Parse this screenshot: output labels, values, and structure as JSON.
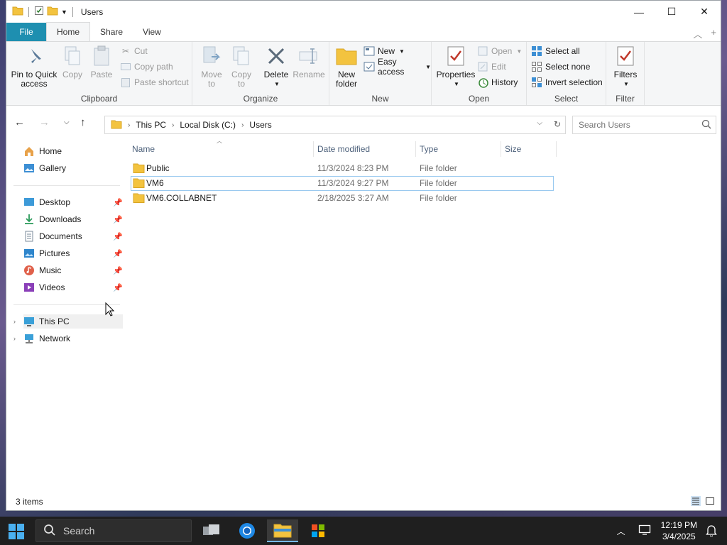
{
  "window": {
    "title": "Users",
    "controls": {
      "minimize": "—",
      "maximize": "☐",
      "close": "✕"
    }
  },
  "ribbon_tabs": [
    {
      "label": "File"
    },
    {
      "label": "Home"
    },
    {
      "label": "Share"
    },
    {
      "label": "View"
    }
  ],
  "ribbon": {
    "clipboard": {
      "group_label": "Clipboard",
      "pin": "Pin to Quick access",
      "pin_l1": "Pin to Quick",
      "pin_l2": "access",
      "copy": "Copy",
      "paste": "Paste",
      "cut": "Cut",
      "copy_path": "Copy path",
      "paste_shortcut": "Paste shortcut"
    },
    "organize": {
      "group_label": "Organize",
      "move_l1": "Move",
      "move_l2": "to",
      "copy_l1": "Copy",
      "copy_l2": "to",
      "delete": "Delete",
      "rename": "Rename"
    },
    "new": {
      "group_label": "New",
      "new_folder_l1": "New",
      "new_folder_l2": "folder",
      "new_item": "New",
      "easy_access": "Easy access"
    },
    "open": {
      "group_label": "Open",
      "properties": "Properties",
      "open": "Open",
      "edit": "Edit",
      "history": "History"
    },
    "select": {
      "group_label": "Select",
      "select_all": "Select all",
      "select_none": "Select none",
      "invert": "Invert selection"
    },
    "filter": {
      "group_label": "Filter",
      "filters": "Filters"
    }
  },
  "address": {
    "crumbs": [
      "This PC",
      "Local Disk (C:)",
      "Users"
    ]
  },
  "search": {
    "placeholder": "Search Users"
  },
  "nav": {
    "home": "Home",
    "gallery": "Gallery",
    "quick": [
      "Desktop",
      "Downloads",
      "Documents",
      "Pictures",
      "Music",
      "Videos"
    ],
    "this_pc": "This PC",
    "network": "Network"
  },
  "columns": {
    "name": "Name",
    "date": "Date modified",
    "type": "Type",
    "size": "Size"
  },
  "files": [
    {
      "name": "Public",
      "date": "11/3/2024 8:23 PM",
      "type": "File folder"
    },
    {
      "name": "VM6",
      "date": "11/3/2024 9:27 PM",
      "type": "File folder"
    },
    {
      "name": "VM6.COLLABNET",
      "date": "2/18/2025 3:27 AM",
      "type": "File folder"
    }
  ],
  "status": {
    "item_count": "3 items"
  },
  "taskbar": {
    "search_label": "Search",
    "time": "12:19 PM",
    "date": "3/4/2025"
  },
  "colors": {
    "accent": "#1e8fb0",
    "folder": "#f3c33f",
    "selection": "#99c9ef"
  }
}
